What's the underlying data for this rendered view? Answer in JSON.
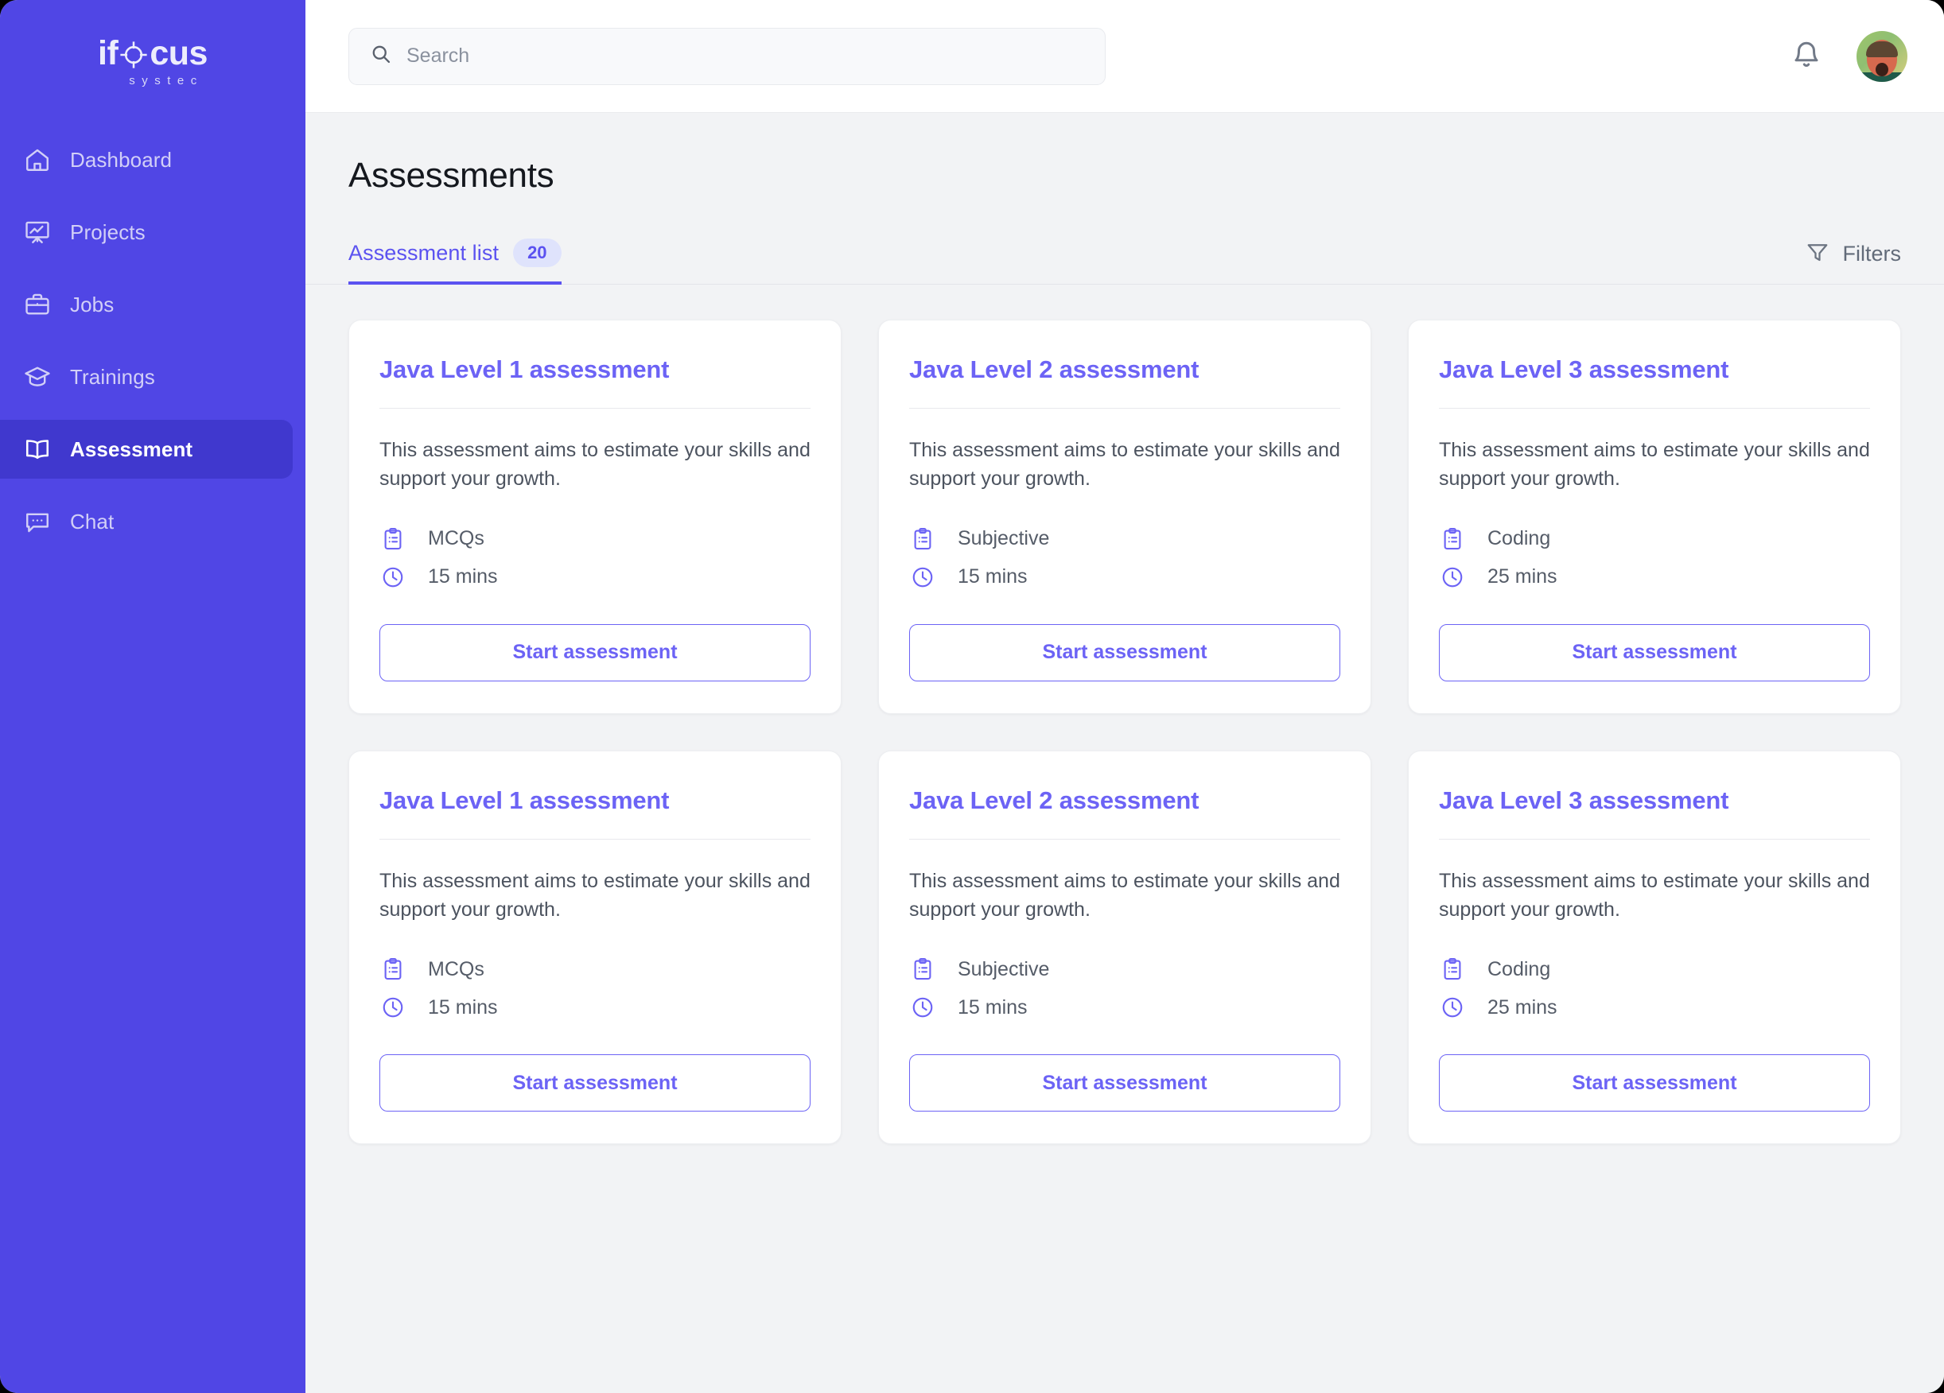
{
  "brand": {
    "name_part1": "if",
    "name_part2": "cus",
    "tagline": "systec"
  },
  "sidebar": {
    "items": [
      {
        "label": "Dashboard",
        "icon": "home-icon",
        "active": false
      },
      {
        "label": "Projects",
        "icon": "presentation-chart-icon",
        "active": false
      },
      {
        "label": "Jobs",
        "icon": "briefcase-icon",
        "active": false
      },
      {
        "label": "Trainings",
        "icon": "graduation-cap-icon",
        "active": false
      },
      {
        "label": "Assessment",
        "icon": "open-book-icon",
        "active": true
      },
      {
        "label": "Chat",
        "icon": "chat-bubble-icon",
        "active": false
      }
    ]
  },
  "topbar": {
    "search_placeholder": "Search",
    "search_value": "",
    "search_icon": "search-icon",
    "notification_icon": "bell-icon",
    "avatar_alt": "user-avatar"
  },
  "page": {
    "title": "Assessments"
  },
  "tabs": {
    "items": [
      {
        "label": "Assessment list",
        "badge": "20",
        "active": true
      }
    ],
    "filters_label": "Filters",
    "filters_icon": "funnel-icon"
  },
  "cards": [
    {
      "title": "Java Level 1 assessment",
      "description": "This assessment aims to estimate your skills and support your growth.",
      "type": "MCQs",
      "type_icon": "clipboard-list-icon",
      "duration": "15 mins",
      "duration_icon": "clock-icon",
      "button": "Start assessment"
    },
    {
      "title": "Java Level 2 assessment",
      "description": "This assessment aims to estimate your skills and support your growth.",
      "type": "Subjective",
      "type_icon": "clipboard-list-icon",
      "duration": "15 mins",
      "duration_icon": "clock-icon",
      "button": "Start assessment"
    },
    {
      "title": "Java Level 3 assessment",
      "description": "This assessment aims to estimate your skills and support your growth.",
      "type": "Coding",
      "type_icon": "clipboard-list-icon",
      "duration": "25 mins",
      "duration_icon": "clock-icon",
      "button": "Start assessment"
    },
    {
      "title": "Java Level 1 assessment",
      "description": "This assessment aims to estimate your skills and support your growth.",
      "type": "MCQs",
      "type_icon": "clipboard-list-icon",
      "duration": "15 mins",
      "duration_icon": "clock-icon",
      "button": "Start assessment"
    },
    {
      "title": "Java Level 2 assessment",
      "description": "This assessment aims to estimate your skills and support your growth.",
      "type": "Subjective",
      "type_icon": "clipboard-list-icon",
      "duration": "15 mins",
      "duration_icon": "clock-icon",
      "button": "Start assessment"
    },
    {
      "title": "Java Level 3 assessment",
      "description": "This assessment aims to estimate your skills and support your growth.",
      "type": "Coding",
      "type_icon": "clipboard-list-icon",
      "duration": "25 mins",
      "duration_icon": "clock-icon",
      "button": "Start assessment"
    }
  ],
  "colors": {
    "sidebar_bg": "#5046E5",
    "sidebar_active_bg": "#4038CE",
    "accent": "#5B52F0",
    "card_title": "#6C63F5",
    "badge_bg": "#DFE3FC",
    "content_bg": "#F2F3F5"
  }
}
